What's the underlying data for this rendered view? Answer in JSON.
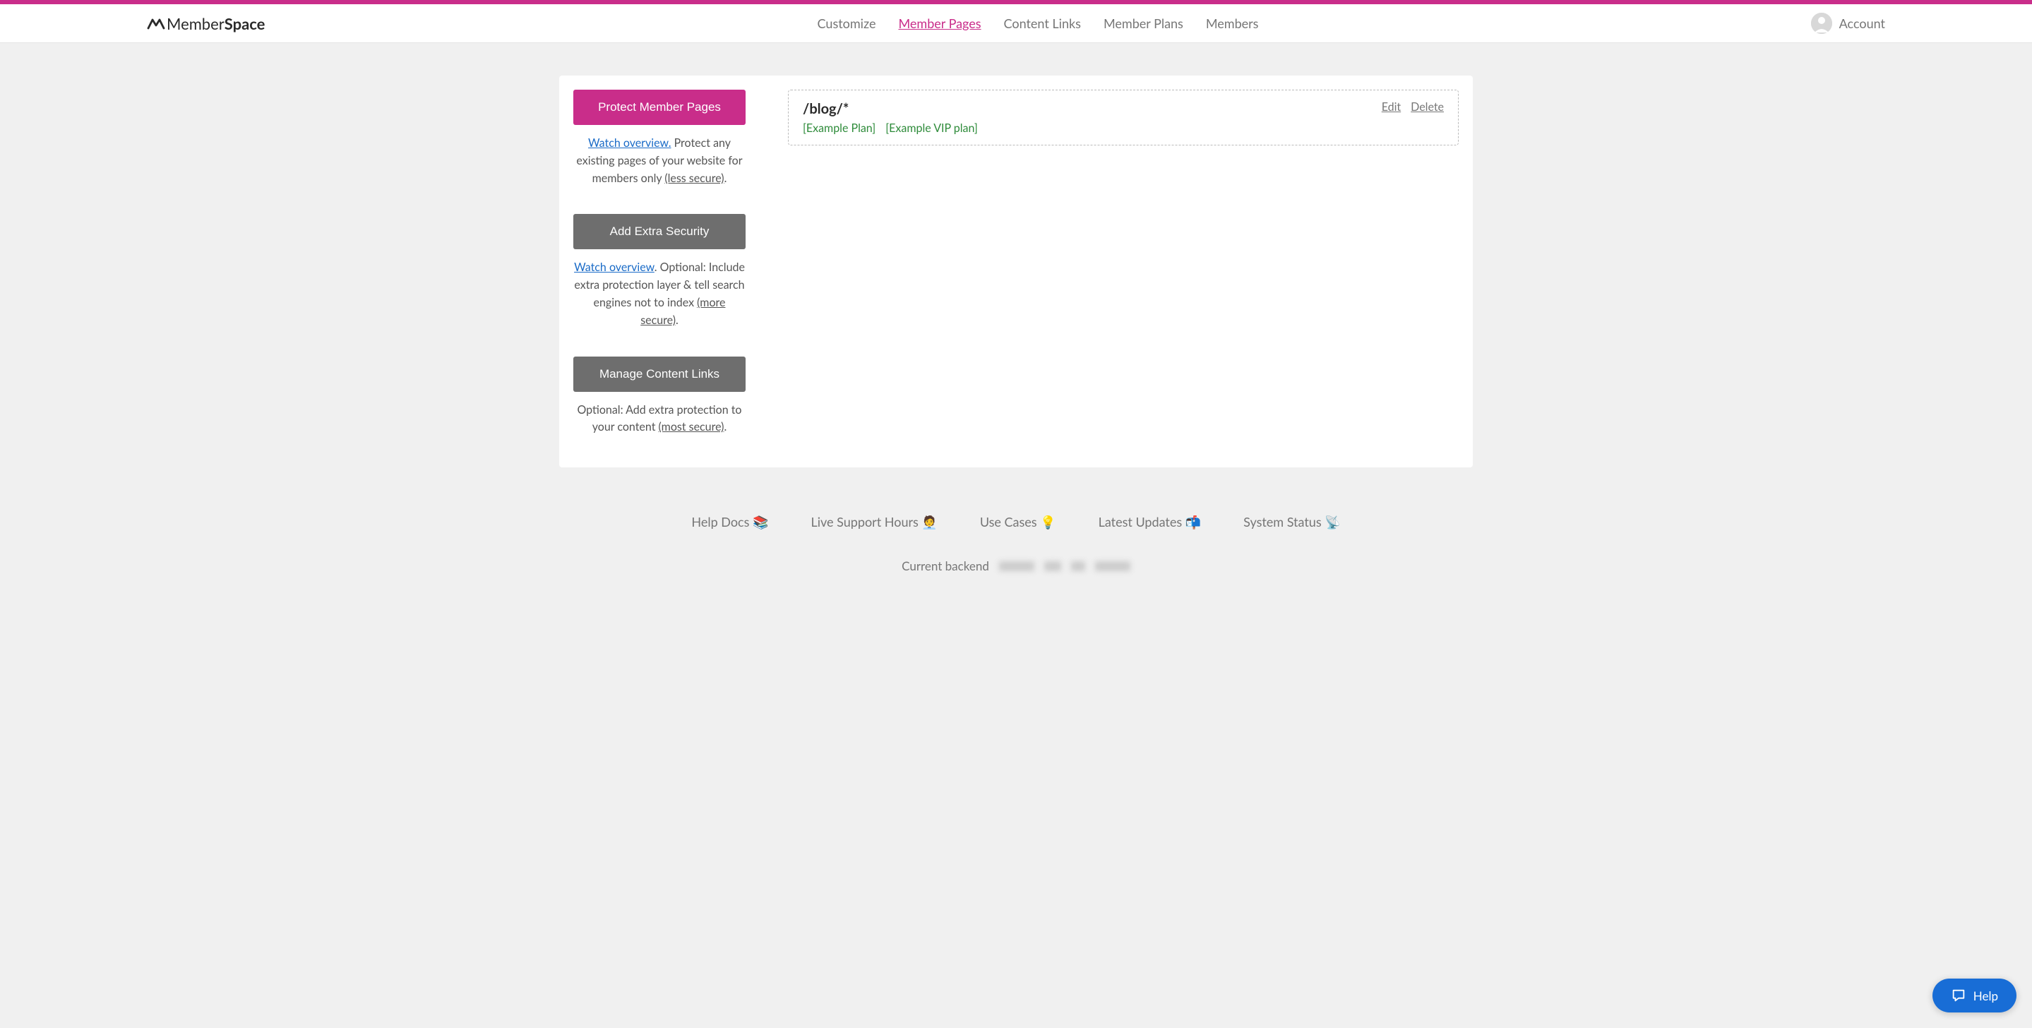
{
  "brand": {
    "part1": "Member",
    "part2": "Space"
  },
  "nav": {
    "customize": "Customize",
    "member_pages": "Member Pages",
    "content_links": "Content Links",
    "member_plans": "Member Plans",
    "members": "Members"
  },
  "account": {
    "label": "Account"
  },
  "sidebar": {
    "protect": {
      "button": "Protect Member Pages",
      "watch": "Watch overview.",
      "desc1": " Protect any existing pages of your website for members only ",
      "secure": "(less secure)",
      "dot": "."
    },
    "security": {
      "button": "Add Extra Security",
      "watch": "Watch overview",
      "desc1": ". Optional: Include extra protection layer & tell search engines not to index ",
      "secure": "(more secure)",
      "dot": "."
    },
    "content": {
      "button": "Manage Content Links",
      "desc1": "Optional: Add extra protection to your content ",
      "secure": "(most secure)",
      "dot": "."
    }
  },
  "page": {
    "path": "/blog/*",
    "plan1": "[Example Plan]",
    "plan2": "[Example VIP plan]",
    "edit": "Edit",
    "delete": "Delete"
  },
  "footer": {
    "help_docs": "Help Docs  📚",
    "live_support": "Live Support Hours  🧑‍💼",
    "use_cases": "Use Cases  💡",
    "latest_updates": "Latest Updates  📬",
    "system_status": "System Status  📡",
    "backend_label": "Current backend"
  },
  "help": {
    "label": "Help"
  }
}
